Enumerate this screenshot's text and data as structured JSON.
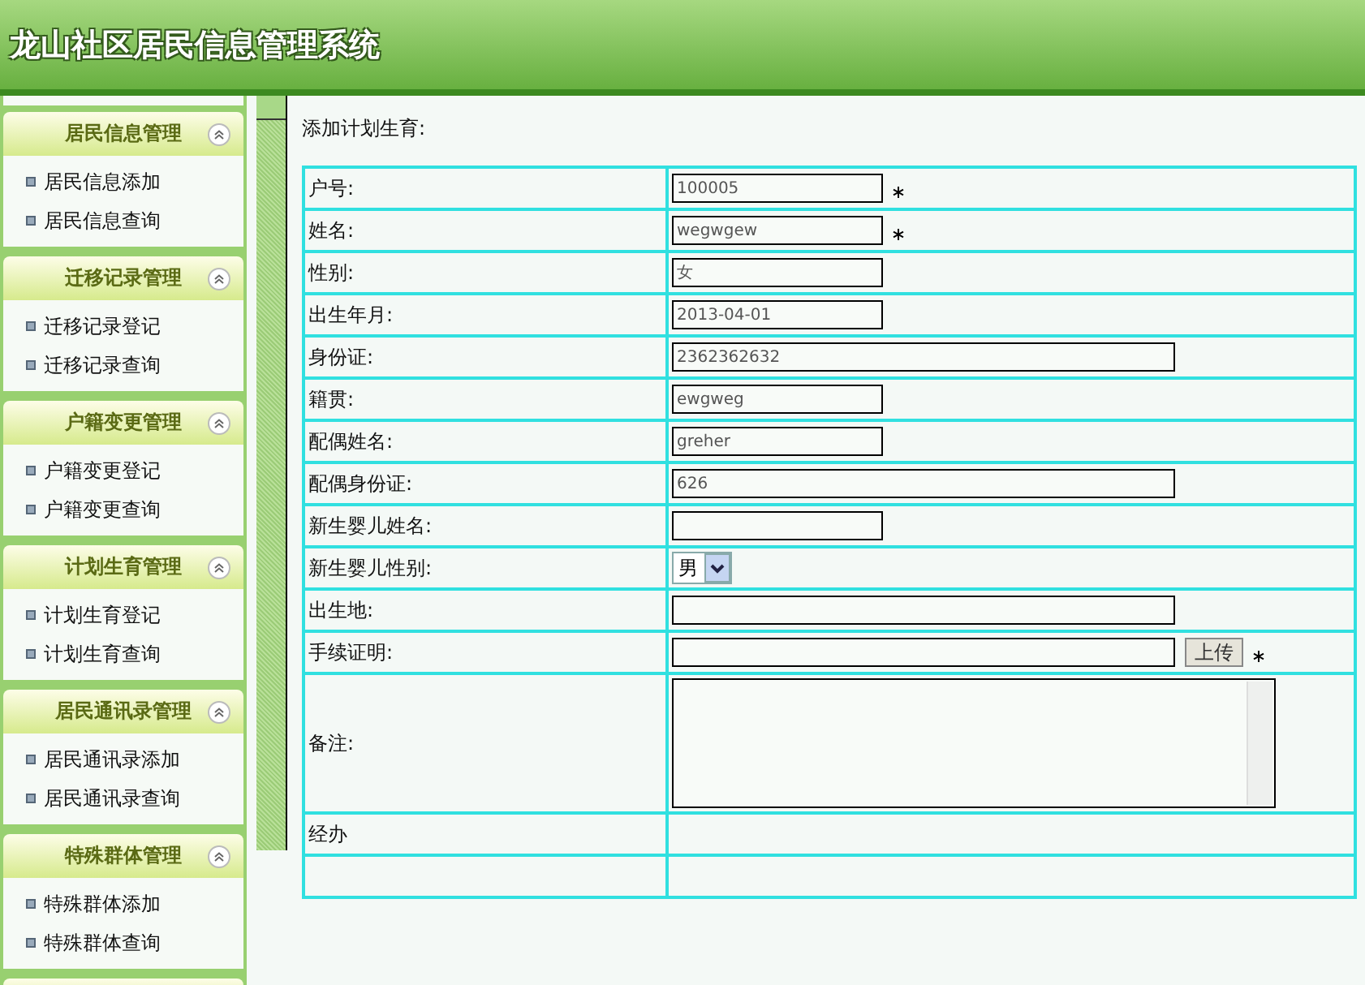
{
  "header": {
    "title": "龙山社区居民信息管理系统"
  },
  "sidebar": {
    "groups": [
      {
        "title": "居民信息管理",
        "expanded": true,
        "items": [
          "居民信息添加",
          "居民信息查询"
        ]
      },
      {
        "title": "迁移记录管理",
        "expanded": true,
        "items": [
          "迁移记录登记",
          "迁移记录查询"
        ]
      },
      {
        "title": "户籍变更管理",
        "expanded": true,
        "items": [
          "户籍变更登记",
          "户籍变更查询"
        ]
      },
      {
        "title": "计划生育管理",
        "expanded": true,
        "items": [
          "计划生育登记",
          "计划生育查询"
        ]
      },
      {
        "title": "居民通讯录管理",
        "expanded": true,
        "items": [
          "居民通讯录添加",
          "居民通讯录查询"
        ]
      },
      {
        "title": "特殊群体管理",
        "expanded": true,
        "items": [
          "特殊群体添加",
          "特殊群体查询"
        ]
      }
    ]
  },
  "form": {
    "title": "添加计划生育:",
    "rows": [
      {
        "label": "户号:",
        "kind": "text",
        "wide": false,
        "value": "100005",
        "required": true
      },
      {
        "label": "姓名:",
        "kind": "text",
        "wide": false,
        "value": "wegwgew",
        "required": true
      },
      {
        "label": "性别:",
        "kind": "text",
        "wide": false,
        "value": "女",
        "required": false
      },
      {
        "label": "出生年月:",
        "kind": "text",
        "wide": false,
        "value": "2013-04-01",
        "required": false
      },
      {
        "label": "身份证:",
        "kind": "text",
        "wide": true,
        "value": "2362362632",
        "required": false
      },
      {
        "label": "籍贯:",
        "kind": "text",
        "wide": false,
        "value": "ewgweg",
        "required": false
      },
      {
        "label": "配偶姓名:",
        "kind": "text",
        "wide": false,
        "value": "greher",
        "required": false
      },
      {
        "label": "配偶身份证:",
        "kind": "text",
        "wide": true,
        "value": "626",
        "required": false
      },
      {
        "label": "新生婴儿姓名:",
        "kind": "text",
        "wide": false,
        "required": false
      },
      {
        "label": "新生婴儿性别:",
        "kind": "select",
        "value": "男",
        "required": false
      },
      {
        "label": "出生地:",
        "kind": "text",
        "wide": true,
        "required": false
      },
      {
        "label": "手续证明:",
        "kind": "file",
        "wide": true,
        "button": "上传",
        "required": true
      },
      {
        "label": "备注:",
        "kind": "textarea",
        "required": false
      },
      {
        "label": "经办",
        "kind": "none"
      },
      {
        "kind": "none"
      }
    ]
  }
}
